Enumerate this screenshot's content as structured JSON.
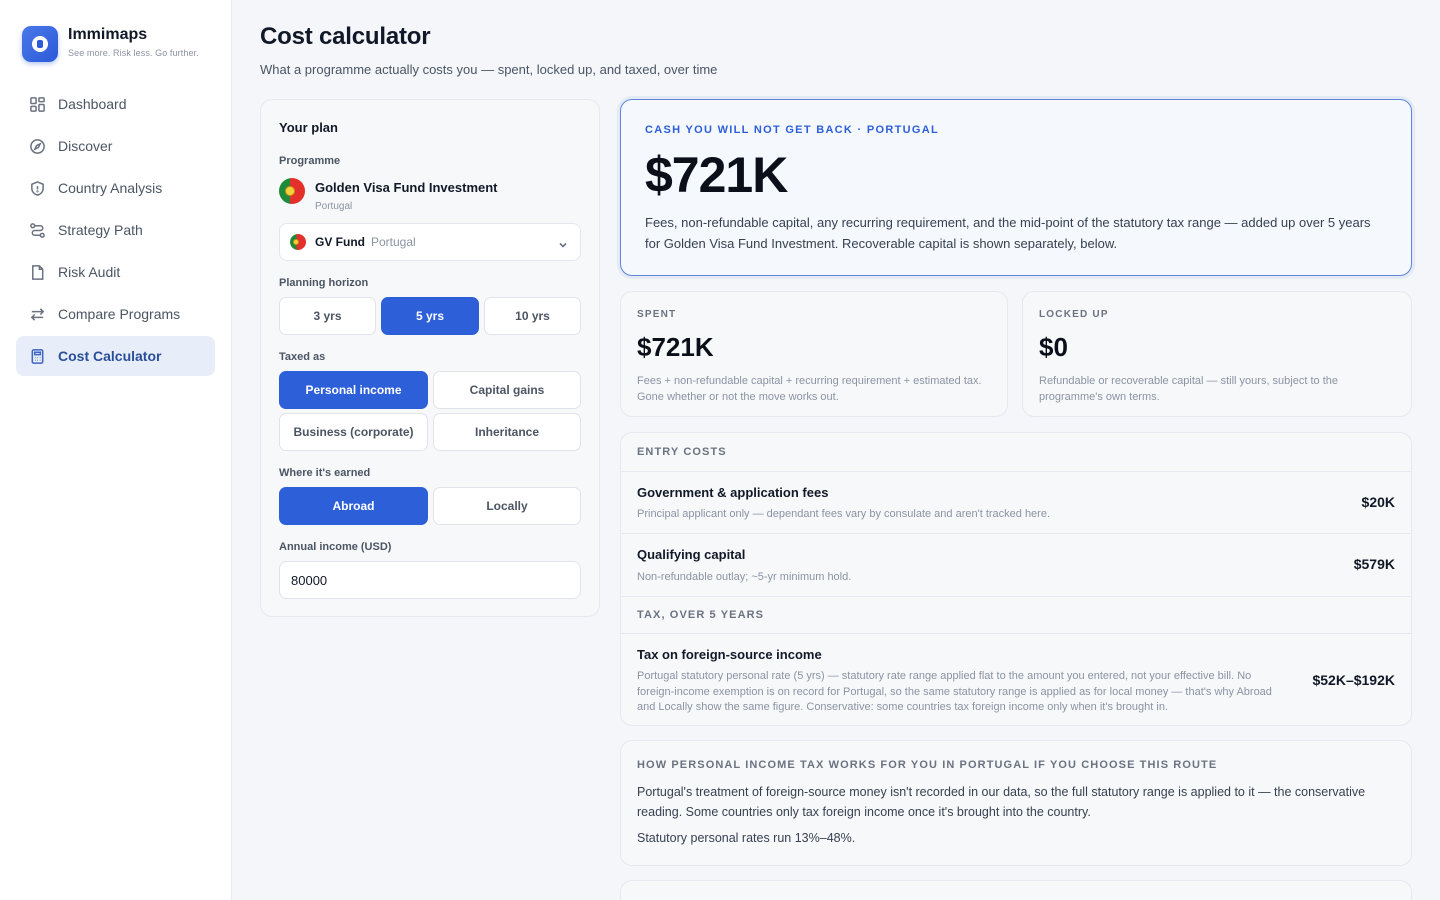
{
  "brand": {
    "name": "Immimaps",
    "tagline": "See more. Risk less. Go further."
  },
  "sidebar": {
    "items": [
      {
        "label": "Dashboard",
        "icon": "dashboard-icon",
        "active": false
      },
      {
        "label": "Discover",
        "icon": "compass-icon",
        "active": false
      },
      {
        "label": "Country Analysis",
        "icon": "shield-icon",
        "active": false
      },
      {
        "label": "Strategy Path",
        "icon": "route-icon",
        "active": false
      },
      {
        "label": "Risk Audit",
        "icon": "document-icon",
        "active": false
      },
      {
        "label": "Compare Programs",
        "icon": "swap-icon",
        "active": false
      },
      {
        "label": "Cost Calculator",
        "icon": "calculator-icon",
        "active": true
      }
    ]
  },
  "header": {
    "title": "Cost calculator",
    "subtitle": "What a programme actually costs you — spent, locked up, and taxed, over time"
  },
  "plan": {
    "title": "Your plan",
    "programme_label": "Programme",
    "programme_name": "Golden Visa Fund Investment",
    "programme_country": "Portugal",
    "select": {
      "name": "GV Fund",
      "country": "Portugal"
    },
    "horizon_label": "Planning horizon",
    "horizon_options": [
      "3 yrs",
      "5 yrs",
      "10 yrs"
    ],
    "horizon_selected": "5 yrs",
    "taxed_label": "Taxed as",
    "taxed_options": [
      "Personal income",
      "Capital gains",
      "Business (corporate)",
      "Inheritance"
    ],
    "taxed_selected": "Personal income",
    "earned_label": "Where it's earned",
    "earned_options": [
      "Abroad",
      "Locally"
    ],
    "earned_selected": "Abroad",
    "income_label": "Annual income (USD)",
    "income_value": "80000"
  },
  "hero": {
    "kicker": "CASH YOU WILL NOT GET BACK · PORTUGAL",
    "amount": "$721K",
    "description": "Fees, non-refundable capital, any recurring requirement, and the mid-point of the statutory tax range — added up over 5 years for Golden Visa Fund Investment. Recoverable capital is shown separately, below."
  },
  "spent": {
    "label": "SPENT",
    "amount": "$721K",
    "description": "Fees + non-refundable capital + recurring requirement + estimated tax. Gone whether or not the move works out."
  },
  "locked": {
    "label": "LOCKED UP",
    "amount": "$0",
    "description": "Refundable or recoverable capital — still yours, subject to the programme's own terms."
  },
  "breakdown": {
    "entry_header": "ENTRY COSTS",
    "gov_title": "Government & application fees",
    "gov_desc": "Principal applicant only — dependant fees vary by consulate and aren't tracked here.",
    "gov_value": "$20K",
    "cap_title": "Qualifying capital",
    "cap_desc": "Non-refundable outlay; ~5-yr minimum hold.",
    "cap_value": "$579K",
    "tax_header": "TAX, OVER 5 YEARS",
    "tax_title": "Tax on foreign-source income",
    "tax_desc": "Portugal statutory personal rate (5 yrs) — statutory rate range applied flat to the amount you entered, not your effective bill. No foreign-income exemption is on record for Portugal, so the same statutory range is applied as for local money — that's why Abroad and Locally show the same figure. Conservative: some countries tax foreign income only when it's brought in.",
    "tax_value": "$52K–$192K"
  },
  "how": {
    "header": "HOW PERSONAL INCOME TAX WORKS FOR YOU IN PORTUGAL IF YOU CHOOSE THIS ROUTE",
    "paragraph": "Portugal's treatment of foreign-source money isn't recorded in our data, so the full statutory range is applied to it — the conservative reading. Some countries only tax foreign income once it's brought into the country.",
    "rates": "Statutory personal rates run 13%–48%."
  },
  "colors": {
    "accent": "#2d5fd9",
    "active_nav_bg": "#e8eef9",
    "hero_border": "#5d86dc"
  }
}
